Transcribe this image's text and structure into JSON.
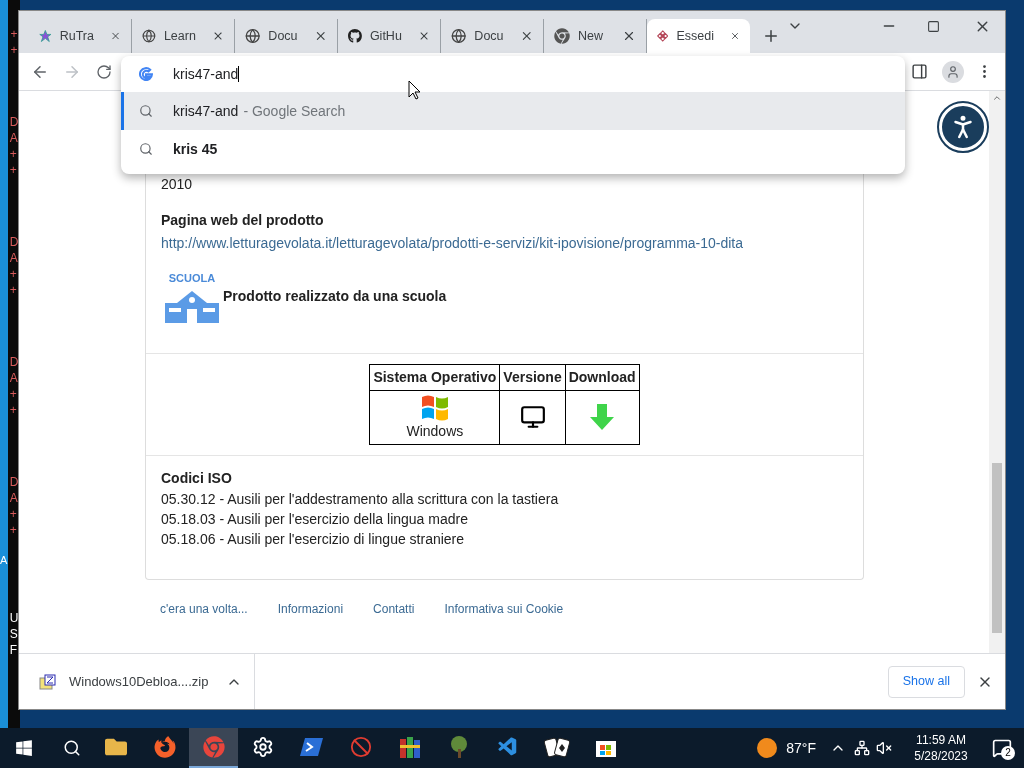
{
  "console": {
    "groups": [
      [
        "+",
        "+"
      ],
      [
        "D",
        "A",
        "+",
        "+"
      ],
      [
        "D",
        "A",
        "+",
        "+"
      ],
      [
        "D",
        "A",
        "+",
        "+"
      ],
      [
        "D",
        "A",
        "+",
        "+"
      ]
    ],
    "footer": [
      "U",
      "S",
      "F"
    ],
    "stray": "A"
  },
  "tabs": [
    {
      "title": "RuTra",
      "kind": "star",
      "selected": false
    },
    {
      "title": "Learn",
      "kind": "globe",
      "selected": false
    },
    {
      "title": "Docu",
      "kind": "globe",
      "selected": false
    },
    {
      "title": "GitHu",
      "kind": "github",
      "selected": false
    },
    {
      "title": "Docu",
      "kind": "globe",
      "selected": false
    },
    {
      "title": "New",
      "kind": "chrome",
      "selected": false
    },
    {
      "title": "Essedi",
      "kind": "knot",
      "selected": true
    }
  ],
  "omnibox": {
    "value": "kris47-and",
    "suggestions": [
      {
        "text": "kris47-and",
        "suffix": "- Google Search",
        "kind": "query",
        "selected": true
      },
      {
        "text": "kris 45",
        "kind": "completion",
        "selected": false
      }
    ]
  },
  "page": {
    "year": "2010",
    "web_label": "Pagina web del prodotto",
    "url": "http://www.letturagevolata.it/letturagevolata/prodotti-e-servizi/kit-ipovisione/programma-10-dita",
    "school_badge": "SCUOLA",
    "school_text": "Prodotto realizzato da una scuola",
    "table": {
      "columns": [
        "Sistema Operativo",
        "Versione",
        "Download"
      ],
      "os": "Windows"
    },
    "iso_title": "Codici ISO",
    "iso_codes": [
      "05.30.12 - Ausili per l'addestramento alla scrittura con la tastiera",
      "05.18.03 - Ausili per l'esercizio della lingua madre",
      "05.18.06 - Ausili per l'esercizio di lingue straniere"
    ],
    "footer_links": [
      "c'era una volta...",
      "Informazioni",
      "Contatti",
      "Informativa sui Cookie"
    ]
  },
  "download_bar": {
    "file": "Windows10Debloa....zip",
    "show_all": "Show all"
  },
  "taskbar": {
    "apps": [
      {
        "kind": "explorer",
        "selected": false
      },
      {
        "kind": "firefox",
        "selected": false
      },
      {
        "kind": "chrome",
        "selected": true
      },
      {
        "kind": "settings",
        "selected": false
      },
      {
        "kind": "powershell",
        "selected": false
      },
      {
        "kind": "blocked",
        "selected": false
      },
      {
        "kind": "books",
        "selected": false
      },
      {
        "kind": "tree",
        "selected": false
      },
      {
        "kind": "vscode",
        "selected": false
      },
      {
        "kind": "cards",
        "selected": false
      },
      {
        "kind": "store",
        "selected": false
      }
    ],
    "temperature": "87°F",
    "time": "11:59 AM",
    "date": "5/28/2023",
    "notifications": "2"
  }
}
